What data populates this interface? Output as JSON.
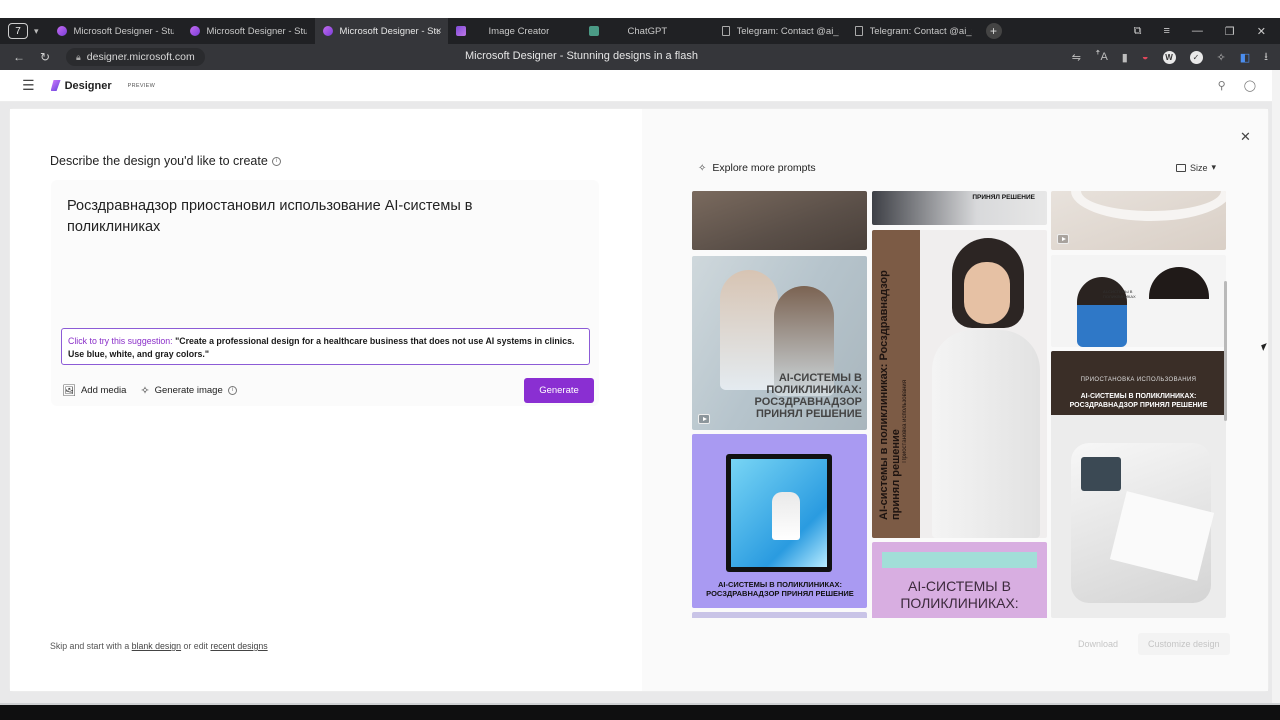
{
  "browser": {
    "tab_count": "7",
    "tabs": [
      {
        "label": "Microsoft Designer - Stunn",
        "icon": "designer-icon",
        "active": false
      },
      {
        "label": "Microsoft Designer - Stunn",
        "icon": "designer-icon",
        "active": false
      },
      {
        "label": "Microsoft Designer - Stu",
        "icon": "designer-icon",
        "active": true
      },
      {
        "label": "Image Creator",
        "icon": "image-creator-icon",
        "active": false
      },
      {
        "label": "ChatGPT",
        "icon": "chatgpt-icon",
        "active": false
      },
      {
        "label": "Telegram: Contact @ai_x_n",
        "icon": "document-icon",
        "active": false
      },
      {
        "label": "Telegram: Contact @ai_x_n",
        "icon": "document-icon",
        "active": false
      }
    ],
    "close_glyph": "×",
    "new_tab_glyph": "+",
    "url": "designer.microsoft.com",
    "page_title": "Microsoft Designer - Stunning designs in a flash"
  },
  "app": {
    "name": "Designer",
    "badge": "PREVIEW"
  },
  "left": {
    "title": "Describe the design you'd like to create",
    "prompt": "Росздравнадзор приостановил использование AI-системы в поликлиниках",
    "suggestion_label": "Click to try this suggestion:",
    "suggestion_text": "\"Create a professional design for a healthcare business that does not use AI systems in clinics. Use blue, white, and gray colors.\"",
    "add_media": "Add media",
    "generate_image": "Generate image",
    "generate_button": "Generate",
    "skip_prefix": "Skip and start with a",
    "blank_design": "blank design",
    "skip_middle": "or edit",
    "recent_designs": "recent designs"
  },
  "right": {
    "explore": "Explore more prompts",
    "size": "Size",
    "download": "Download",
    "customize": "Customize design",
    "cards": {
      "c2_text": "AI-СИСТЕМЫ В ПОЛИКЛИНИКАХ: РОСЗДРАВНАДЗОР ПРИНЯЛ РЕШЕНИЕ",
      "c3_text": "AI-СИСТЕМЫ В ПОЛИКЛИНИКАХ: РОСЗДРАВНАДЗОР ПРИНЯЛ РЕШЕНИЕ",
      "c4_tag": "ПРИНЯЛ РЕШЕНИЕ",
      "c5_vertical": "AI-системы в поликлиниках: Росздравнадзор принял решение",
      "c5_vertical_small": "Приостановка использования",
      "c6_text": "AI-СИСТЕМЫ В ПОЛИКЛИНИКАХ:",
      "c8_text": "AI-СИСТЕМЫ В ПОЛИКЛИНИКАХ",
      "c9_kicker": "ПРИОСТАНОВКА ИСПОЛЬЗОВАНИЯ",
      "c9_title": "AI-СИСТЕМЫ В ПОЛИКЛИНИКАХ: РОСЗДРАВНАДЗОР ПРИНЯЛ РЕШЕНИЕ"
    }
  },
  "colors": {
    "accent": "#8a2fd2",
    "suggestion_border": "#8c5bd6"
  }
}
